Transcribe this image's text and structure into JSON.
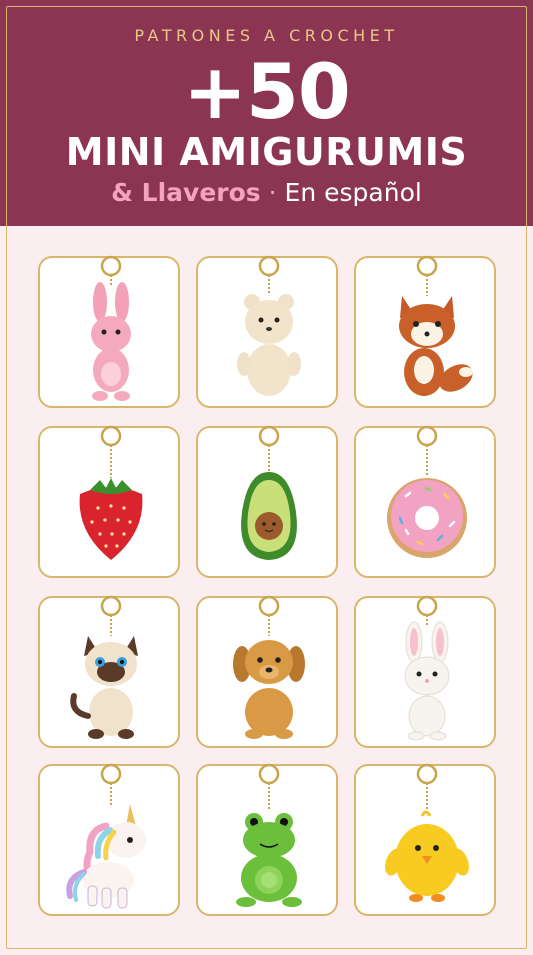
{
  "header": {
    "kicker": "PATRONES A CROCHET",
    "big_number": "+50",
    "headline": "MINI AMIGURUMIS",
    "subline_accent": "& Llaveros",
    "subline_separator": "·",
    "subline_rest": "En español"
  },
  "colors": {
    "header_bg": "#8c3553",
    "gold": "#d9b66c",
    "pink_accent": "#f3a3bb",
    "page_bg": "#fbeef0"
  },
  "keychains": [
    {
      "name": "pink-bunny",
      "icon": "pink-bunny-icon"
    },
    {
      "name": "cream-bear",
      "icon": "bear-icon"
    },
    {
      "name": "fox",
      "icon": "fox-icon"
    },
    {
      "name": "strawberry",
      "icon": "strawberry-icon"
    },
    {
      "name": "avocado",
      "icon": "avocado-icon"
    },
    {
      "name": "donut",
      "icon": "donut-icon"
    },
    {
      "name": "siamese-cat",
      "icon": "cat-icon"
    },
    {
      "name": "puppy",
      "icon": "puppy-icon"
    },
    {
      "name": "white-bunny",
      "icon": "white-bunny-icon"
    },
    {
      "name": "unicorn",
      "icon": "unicorn-icon"
    },
    {
      "name": "frog",
      "icon": "frog-icon"
    },
    {
      "name": "chick",
      "icon": "chick-icon"
    }
  ]
}
